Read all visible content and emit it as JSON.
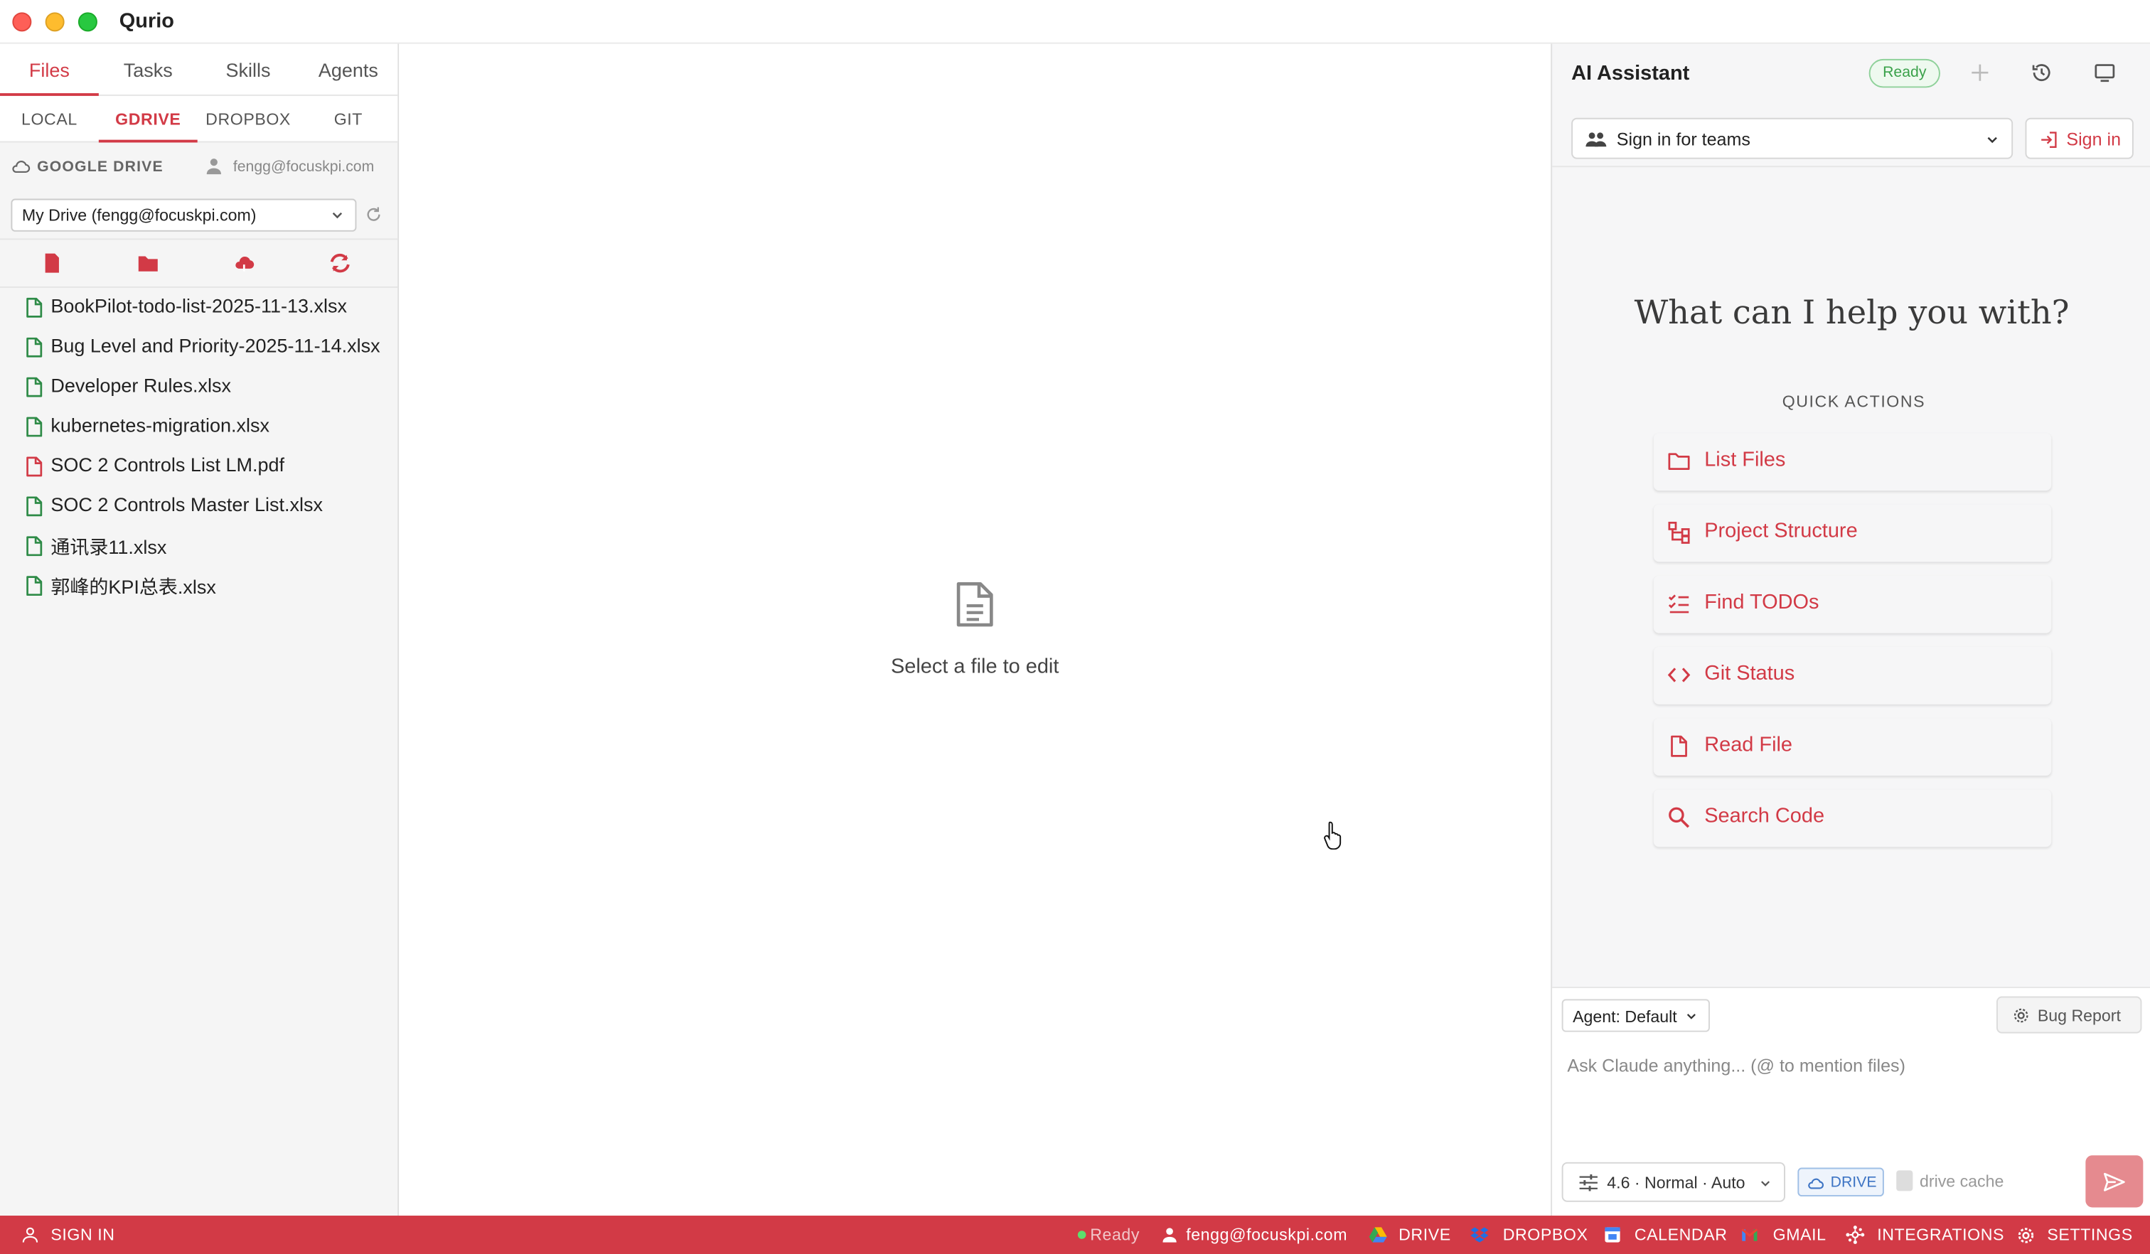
{
  "window": {
    "title": "Qurio"
  },
  "sidebar": {
    "tabs": [
      "Files",
      "Tasks",
      "Skills",
      "Agents"
    ],
    "active_tab": "Files",
    "sources": [
      "LOCAL",
      "GDRIVE",
      "DROPBOX",
      "GIT"
    ],
    "active_source": "GDRIVE",
    "drive_label": "GOOGLE DRIVE",
    "drive_user": "fengg@focuskpi.com",
    "drive_select": "My Drive (fengg@focuskpi.com)",
    "toolbar_icons": [
      "new-file-icon",
      "new-folder-icon",
      "cloud-icon",
      "sync-icon"
    ],
    "files": [
      {
        "name": "BookPilot-todo-list-2025-11-13.xlsx",
        "type": "xlsx"
      },
      {
        "name": "Bug Level and Priority-2025-11-14.xlsx",
        "type": "xlsx"
      },
      {
        "name": "Developer Rules.xlsx",
        "type": "xlsx"
      },
      {
        "name": "kubernetes-migration.xlsx",
        "type": "xlsx"
      },
      {
        "name": "SOC 2 Controls List LM.pdf",
        "type": "pdf"
      },
      {
        "name": "SOC 2 Controls Master List.xlsx",
        "type": "xlsx"
      },
      {
        "name": "通讯录11.xlsx",
        "type": "xlsx"
      },
      {
        "name": "郭峰的KPI总表.xlsx",
        "type": "xlsx"
      }
    ]
  },
  "editor": {
    "empty_text": "Select a file to edit"
  },
  "assistant": {
    "title": "AI Assistant",
    "status": "Ready",
    "team_select": "Sign in for teams",
    "signin_label": "Sign in",
    "help_title": "What can I help you with?",
    "quick_actions_label": "QUICK ACTIONS",
    "quick_actions": [
      {
        "label": "List Files",
        "icon": "folder-icon"
      },
      {
        "label": "Project Structure",
        "icon": "hierarchy-icon"
      },
      {
        "label": "Find TODOs",
        "icon": "checklist-icon"
      },
      {
        "label": "Git Status",
        "icon": "code-icon"
      },
      {
        "label": "Read File",
        "icon": "file-icon"
      },
      {
        "label": "Search Code",
        "icon": "search-icon"
      }
    ],
    "agent_select": "Agent: Default",
    "bug_report": "Bug Report",
    "prompt_placeholder": "Ask Claude anything... (@ to mention files)",
    "model_select": "4.6 · Normal · Auto",
    "drive_chip": "DRIVE",
    "cache_label": "drive cache"
  },
  "statusbar": {
    "sign_in": "SIGN IN",
    "ready": "Ready",
    "user": "fengg@focuskpi.com",
    "drive": "DRIVE",
    "dropbox": "DROPBOX",
    "calendar": "CALENDAR",
    "gmail": "GMAIL",
    "integrations": "INTEGRATIONS",
    "settings": "SETTINGS"
  },
  "colors": {
    "accent": "#d23a46",
    "xlsx_icon": "#2e8b47",
    "pdf_icon": "#d23a46",
    "ready_green": "#3aa14a",
    "drive_blue": "#3d74c4"
  }
}
